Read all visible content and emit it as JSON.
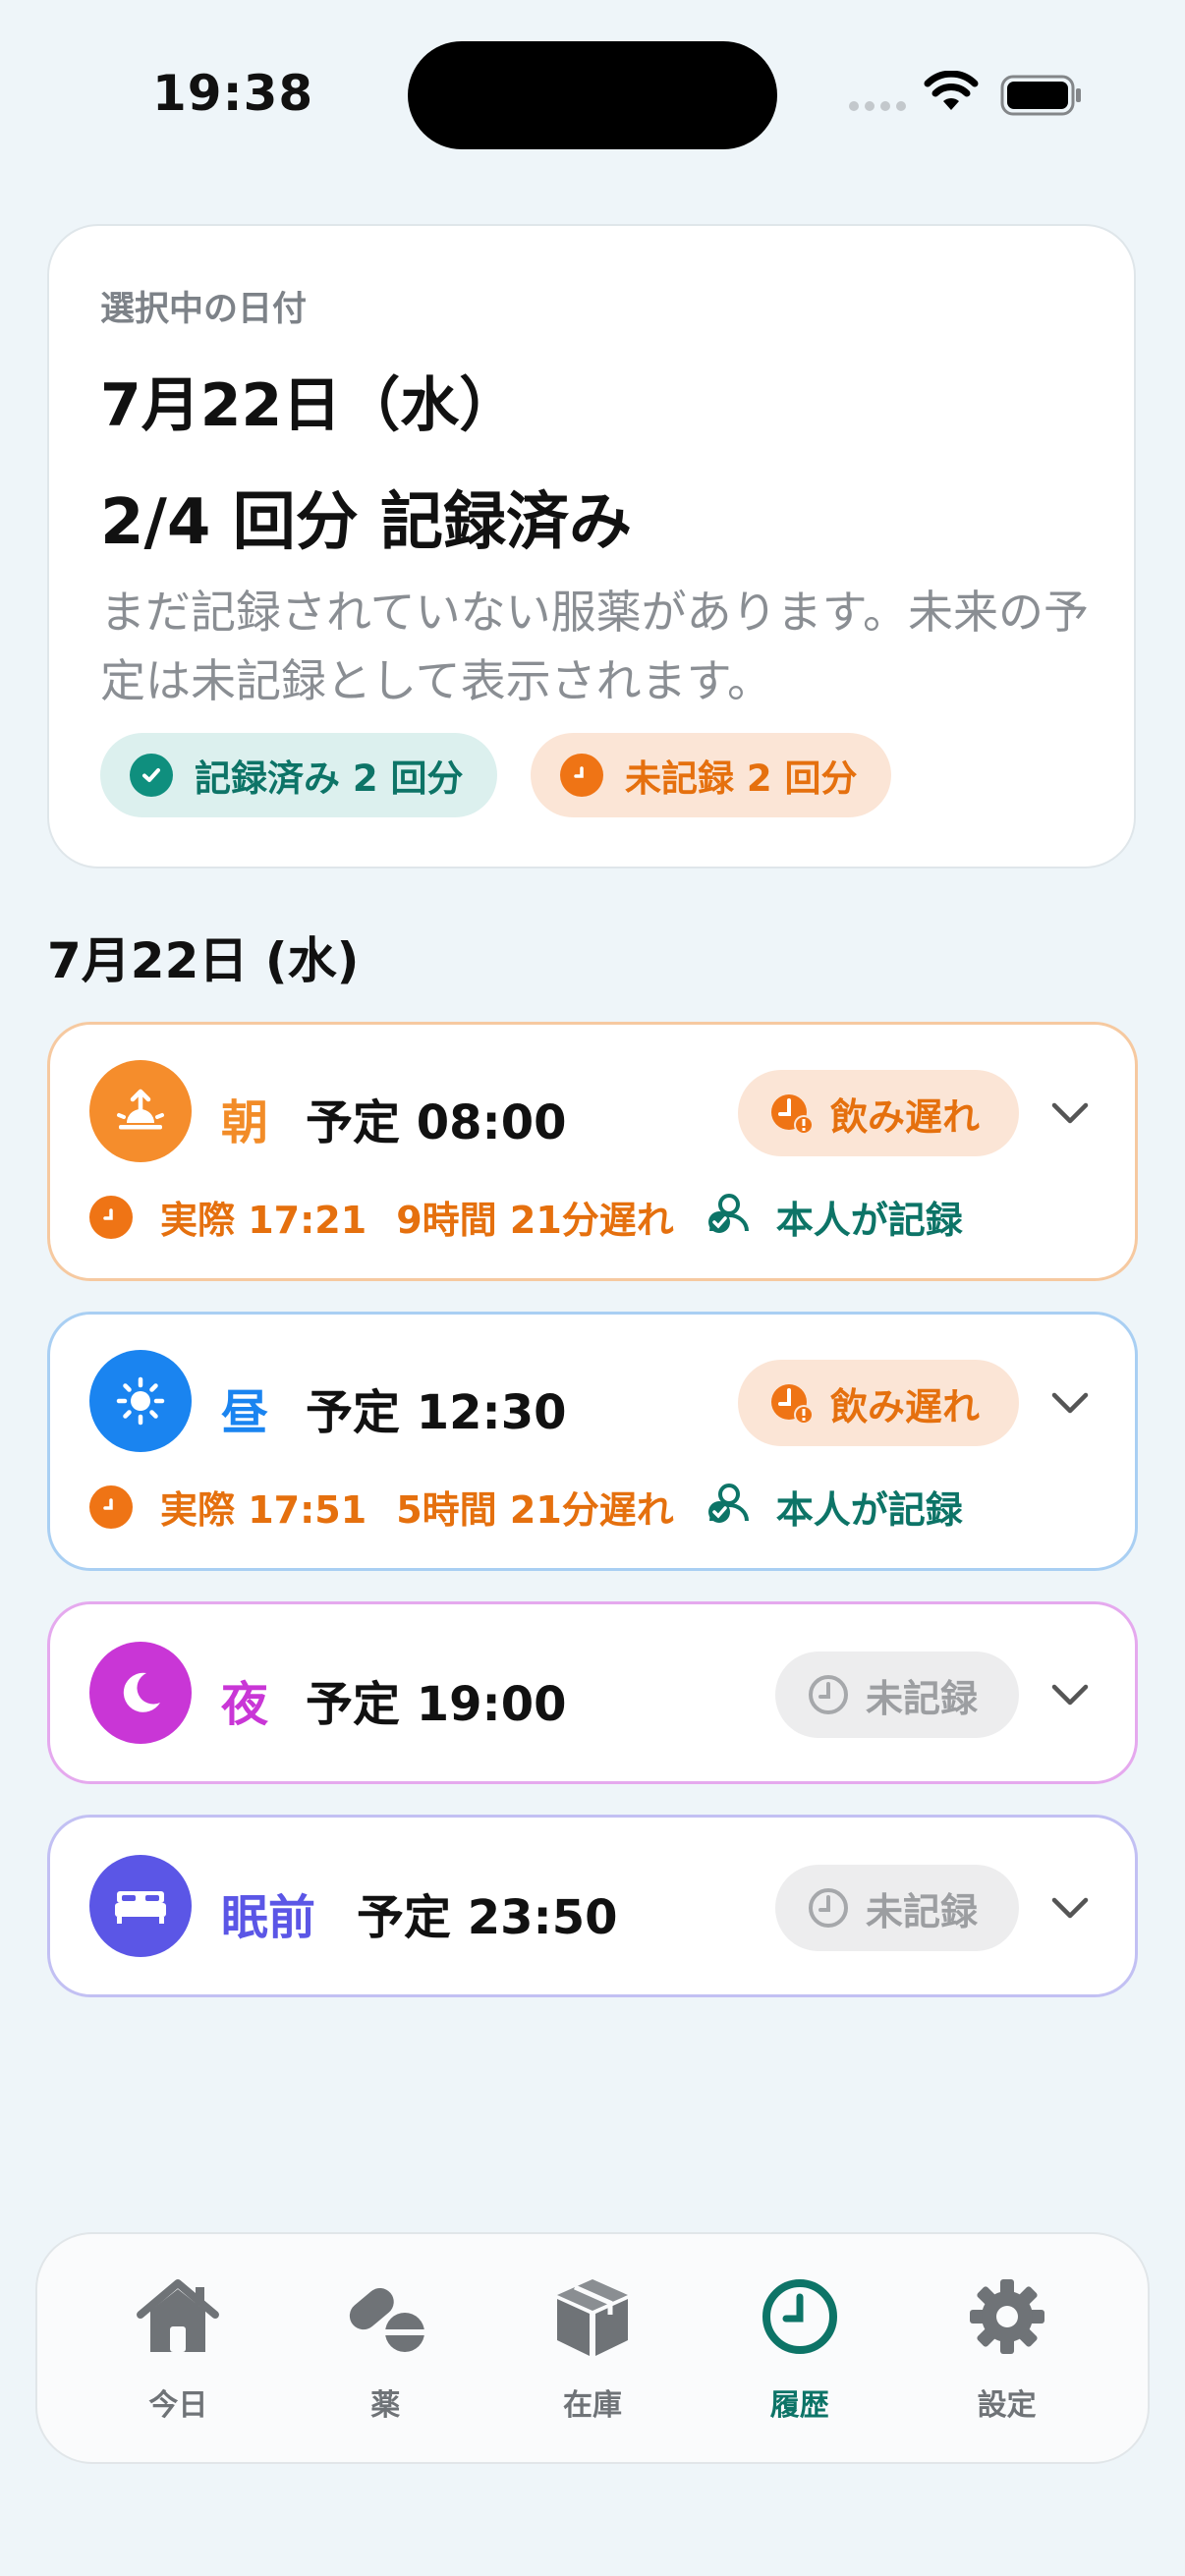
{
  "status_bar": {
    "time": "19:38"
  },
  "summary": {
    "label": "選択中の日付",
    "date": "7月22日（水）",
    "count": "2/4 回分 記録済み",
    "note": "まだ記録されていない服薬があります。未来の予定は未記録として表示されます。",
    "chip_done": "記録済み 2 回分",
    "chip_pending": "未記録 2 回分"
  },
  "section_date": "7月22日 (水)",
  "doses": [
    {
      "name": "朝",
      "scheduled": "予定 08:00",
      "status": "飲み遅れ",
      "actual": "実際 17:21",
      "delay": "9時間 21分遅れ",
      "recorded_by": "本人が記録",
      "icon": "sunrise-icon",
      "color": "#f28c28"
    },
    {
      "name": "昼",
      "scheduled": "予定 12:30",
      "status": "飲み遅れ",
      "actual": "実際 17:51",
      "delay": "5時間 21分遅れ",
      "recorded_by": "本人が記録",
      "icon": "sun-icon",
      "color": "#1a84f0"
    },
    {
      "name": "夜",
      "scheduled": "予定 19:00",
      "status": "未記録",
      "icon": "moon-icon",
      "color": "#c936d6"
    },
    {
      "name": "眠前",
      "scheduled": "予定 23:50",
      "status": "未記録",
      "icon": "bed-icon",
      "color": "#5b56e6"
    }
  ],
  "tabs": [
    {
      "label": "今日",
      "icon": "home-icon"
    },
    {
      "label": "薬",
      "icon": "pills-icon"
    },
    {
      "label": "在庫",
      "icon": "box-icon"
    },
    {
      "label": "履歴",
      "icon": "clock-icon",
      "active": true
    },
    {
      "label": "設定",
      "icon": "gear-icon"
    }
  ],
  "colors": {
    "accent": "#0d7467",
    "late": "#e5700e",
    "background": "#eef5f9"
  }
}
